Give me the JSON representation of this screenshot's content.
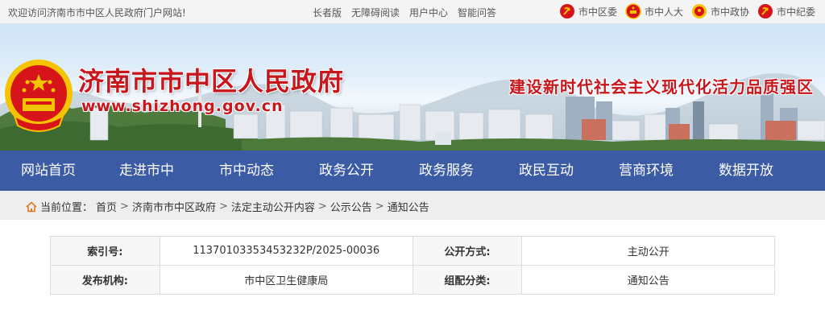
{
  "topbar": {
    "welcome": "欢迎访问济南市市中区人民政府门户网站!",
    "links": [
      "长者版",
      "无障碍阅读",
      "用户中心",
      "智能问答"
    ],
    "orgs": [
      {
        "label": "市中区委",
        "icon": "party-emblem-icon"
      },
      {
        "label": "市中人大",
        "icon": "national-emblem-icon"
      },
      {
        "label": "市中政协",
        "icon": "cppcc-emblem-icon"
      },
      {
        "label": "市中纪委",
        "icon": "party-emblem-icon"
      }
    ]
  },
  "banner": {
    "title": "济南市市中区人民政府",
    "url": "www.shizhong.gov.cn",
    "slogan": "建设新时代社会主义现代化活力品质强区"
  },
  "nav": {
    "items": [
      "网站首页",
      "走进市中",
      "市中动态",
      "政务公开",
      "政务服务",
      "政民互动",
      "营商环境",
      "数据开放"
    ]
  },
  "breadcrumb": {
    "prefix": "当前位置：",
    "items": [
      "首页",
      "济南市市中区政府",
      "法定主动公开内容",
      "公示公告",
      "通知公告"
    ],
    "separator": ">"
  },
  "info": {
    "rows": [
      {
        "k1": "索引号:",
        "v1": "11370103353453232P/2025-00036",
        "k2": "公开方式:",
        "v2": "主动公开"
      },
      {
        "k1": "发布机构:",
        "v1": "市中区卫生健康局",
        "k2": "组配分类:",
        "v2": "通知公告"
      }
    ]
  },
  "colors": {
    "brand_red": "#c8161d",
    "nav_blue": "#3b5ba5",
    "gold": "#f5c400"
  }
}
